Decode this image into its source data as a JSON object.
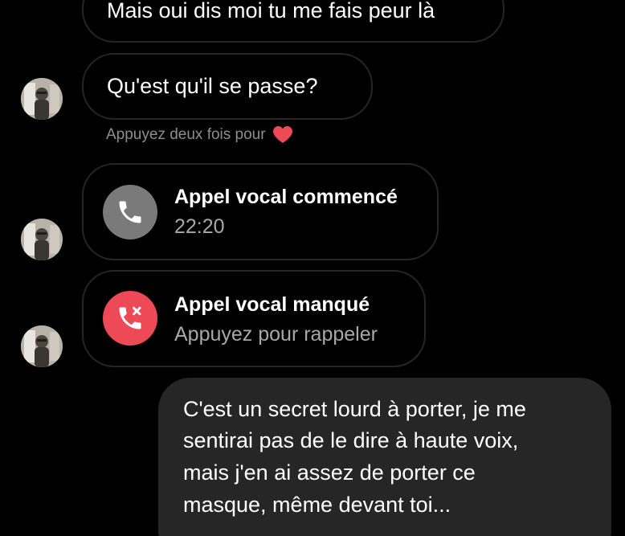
{
  "messages": {
    "incoming_1": "Mais oui dis moi tu me fais peur là",
    "incoming_2": "Qu'est qu'il se passe?",
    "hint": "Appuyez deux fois pour",
    "call_started": {
      "title": "Appel vocal commencé",
      "time": "22:20"
    },
    "call_missed": {
      "title": "Appel vocal manqué",
      "subtitle": "Appuyez pour rappeler"
    },
    "outgoing": {
      "lines": [
        "C'est un secret lourd à porter, je me",
        "sentirai pas de le dire à haute voix,",
        "mais j'en ai assez de porter ce",
        "masque, même devant toi..."
      ]
    }
  },
  "icons": {
    "heart": "heart-icon",
    "phone": "phone-icon",
    "missed_call": "missed-call-icon"
  },
  "colors": {
    "background": "#000000",
    "incoming_border": "#262626",
    "outgoing_bg": "#262626",
    "call_started_icon_bg": "#7a7a7a",
    "call_missed_icon_bg": "#ed4956",
    "heart": "#ed4956",
    "muted_text": "#8e8e8e"
  }
}
